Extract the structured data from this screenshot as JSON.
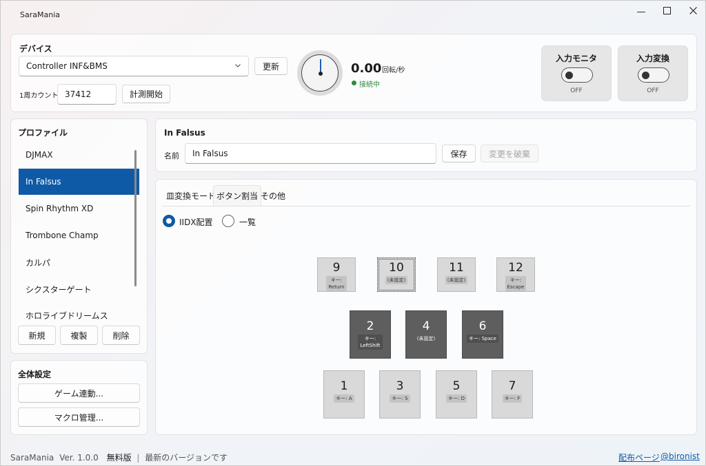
{
  "window": {
    "title": "SaraMania",
    "min_icon": "minimize-icon",
    "max_icon": "maximize-icon",
    "close_icon": "close-icon"
  },
  "device": {
    "heading": "デバイス",
    "selected": "Controller INF&BMS",
    "refresh_label": "更新",
    "count_label": "1周カウント",
    "count_value": "37412",
    "measure_label": "計測開始"
  },
  "rpm": {
    "value": "0.00",
    "unit": "回転/秒",
    "status": "接続中",
    "status_color": "#2e8b3a"
  },
  "toggles": [
    {
      "title": "入力モニタ",
      "state": "OFF"
    },
    {
      "title": "入力変換",
      "state": "OFF"
    }
  ],
  "profiles": {
    "heading": "プロファイル",
    "items": [
      "DJMAX",
      "In Falsus",
      "Spin Rhythm XD",
      "Trombone Champ",
      "カルパ",
      "シクスターゲート",
      "ホロライブドリームス"
    ],
    "selected_index": 1,
    "new_label": "新規",
    "copy_label": "複製",
    "delete_label": "削除"
  },
  "global_settings": {
    "heading": "全体設定",
    "game_link_label": "ゲーム連動...",
    "macro_label": "マクロ管理..."
  },
  "profile_editor": {
    "title": "In Falsus",
    "name_label": "名前",
    "name_value": "In Falsus",
    "save_label": "保存",
    "discard_label": "変更を破棄"
  },
  "tabs": [
    "皿変換モード",
    "ボタン割当",
    "その他"
  ],
  "active_tab": 1,
  "layout_options": {
    "iidx_label": "IIDX配置",
    "list_label": "一覧",
    "selected": "iidx"
  },
  "keys": {
    "top": [
      {
        "num": "9",
        "bind": "キー:\nReturn"
      },
      {
        "num": "10",
        "bind": "(未設定)"
      },
      {
        "num": "11",
        "bind": "(未設定)"
      },
      {
        "num": "12",
        "bind": "キー:\nEscape"
      }
    ],
    "middle": [
      {
        "num": "2",
        "bind": "キー:\nLeftShift"
      },
      {
        "num": "4",
        "bind": "(未設定)"
      },
      {
        "num": "6",
        "bind": "キー: Space"
      }
    ],
    "bottom": [
      {
        "num": "1",
        "bind": "キー: A"
      },
      {
        "num": "3",
        "bind": "キー: S"
      },
      {
        "num": "5",
        "bind": "キー: D"
      },
      {
        "num": "7",
        "bind": "キー: F"
      }
    ]
  },
  "footer": {
    "app": "SaraMania",
    "version": "Ver. 1.0.0",
    "edition": "無料版",
    "separator": "|",
    "update_status": "最新のバージョンです",
    "dist_link": "配布ページ",
    "author_link": "@bironist"
  },
  "colors": {
    "accent": "#0f5aa6",
    "key_dark": "#5e5e5e",
    "key_light": "#d9d9d9"
  }
}
